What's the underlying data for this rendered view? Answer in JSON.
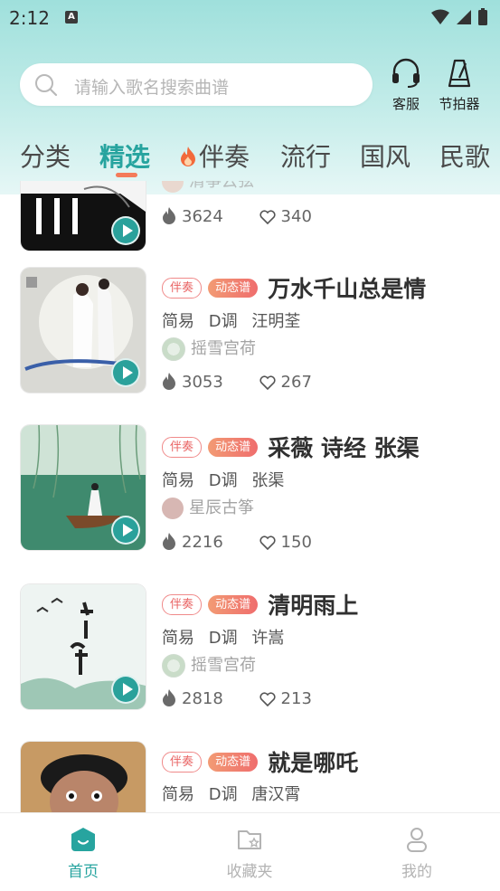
{
  "status_bar": {
    "time": "2:12",
    "notif_icon": "A"
  },
  "search": {
    "placeholder": "请输入歌名搜索曲谱"
  },
  "top_buttons": [
    {
      "label": "客服",
      "icon": "headset-icon"
    },
    {
      "label": "节拍器",
      "icon": "metronome-icon"
    }
  ],
  "tabs": [
    {
      "label": "分类",
      "active": false
    },
    {
      "label": "精选",
      "active": true
    },
    {
      "label": "伴奏",
      "active": false,
      "icon": "fire-icon"
    },
    {
      "label": "流行",
      "active": false
    },
    {
      "label": "国风",
      "active": false
    },
    {
      "label": "民歌",
      "active": false
    }
  ],
  "songs": [
    {
      "title": "",
      "author": "清筝云弦",
      "plays": "3624",
      "likes": "340"
    },
    {
      "badge1": "伴奏",
      "badge2": "动态谱",
      "title": "万水千山总是情",
      "meta": [
        "简易",
        "D调",
        "汪明荃"
      ],
      "author": "摇雪宫荷",
      "plays": "3053",
      "likes": "267"
    },
    {
      "badge1": "伴奏",
      "badge2": "动态谱",
      "title": "采薇 诗经 张渠",
      "meta": [
        "简易",
        "D调",
        "张渠"
      ],
      "author": "星辰古筝",
      "plays": "2216",
      "likes": "150"
    },
    {
      "badge1": "伴奏",
      "badge2": "动态谱",
      "title": "清明雨上",
      "meta": [
        "简易",
        "D调",
        "许嵩"
      ],
      "author": "摇雪宫荷",
      "plays": "2818",
      "likes": "213"
    },
    {
      "badge1": "伴奏",
      "badge2": "动态谱",
      "title": "就是哪吒",
      "meta": [
        "简易",
        "D调",
        "唐汉霄"
      ],
      "author": "",
      "plays": "",
      "likes": ""
    }
  ],
  "bottom_nav": [
    {
      "label": "首页",
      "active": true
    },
    {
      "label": "收藏夹",
      "active": false
    },
    {
      "label": "我的",
      "active": false
    }
  ],
  "colors": {
    "accent": "#27a49f",
    "badge_red": "#e96363",
    "header_bg": "#9fe0dc"
  }
}
